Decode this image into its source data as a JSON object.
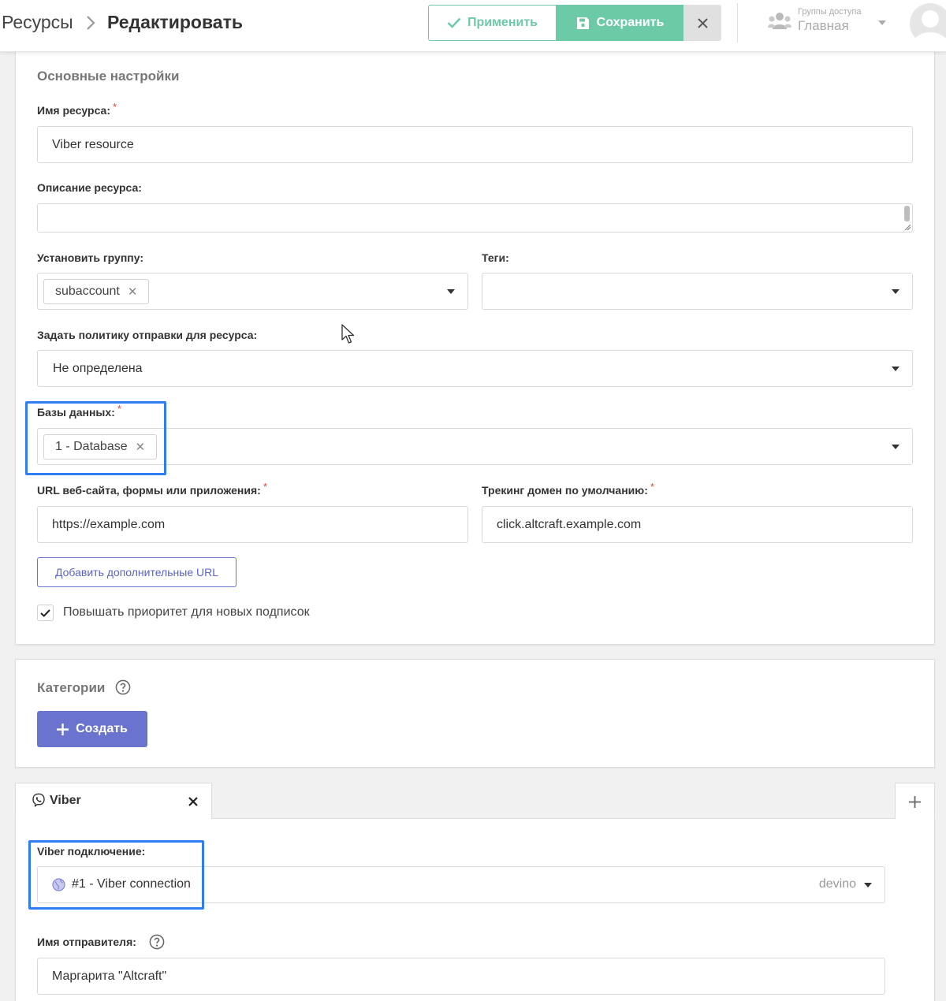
{
  "header": {
    "breadcrumb_root": "Ресурсы",
    "breadcrumb_current": "Редактировать",
    "apply_label": "Применить",
    "save_label": "Сохранить",
    "access_groups_label": "Группы доступа",
    "access_groups_value": "Главная"
  },
  "basic": {
    "title": "Основные настройки",
    "name_label": "Имя ресурса:",
    "name_value": "Viber resource",
    "description_label": "Описание ресурса:",
    "description_value": "",
    "group_label": "Установить группу:",
    "group_chip": "subaccount",
    "tags_label": "Теги:",
    "policy_label": "Задать политику отправки для ресурса:",
    "policy_value": "Не определена",
    "databases_label": "Базы данных:",
    "database_chip": "1 - Database",
    "url_label": "URL веб-сайта, формы или приложения:",
    "url_value": "https://example.com",
    "tracking_label": "Трекинг домен по умолчанию:",
    "tracking_value": "click.altcraft.example.com",
    "add_url_label": "Добавить дополнительные URL",
    "priority_label": "Повышать приоритет для новых подписок",
    "priority_checked": true
  },
  "categories": {
    "title": "Категории",
    "create_label": "Создать"
  },
  "channel": {
    "tab_label": "Viber",
    "connection_label": "Viber подключение:",
    "connection_value": "#1 - Viber connection",
    "connection_provider": "devino",
    "sender_label": "Имя отправителя:",
    "sender_value": "Маргарита \"Altcraft\""
  },
  "colors": {
    "accent_green": "#6dcaa7",
    "primary_button": "#6a74cf",
    "highlight": "#2f7df6",
    "required": "#e0483b"
  }
}
